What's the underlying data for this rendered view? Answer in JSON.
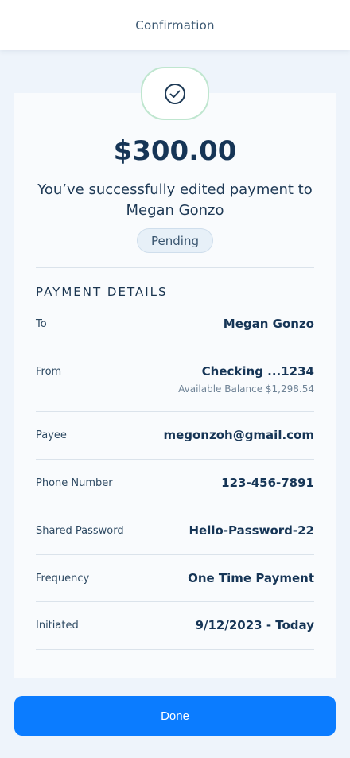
{
  "header": {
    "title": "Confirmation"
  },
  "summary": {
    "amount": "$300.00",
    "message": "You’ve successfully edited payment to Megan Gonzo",
    "status": "Pending",
    "status_icon": "check-circle-icon"
  },
  "details": {
    "section_title": "PAYMENT DETAILS",
    "rows": [
      {
        "label": "To",
        "value": "Megan Gonzo"
      },
      {
        "label": "From",
        "value": "Checking ...1234",
        "sub": "Available Balance $1,298.54"
      },
      {
        "label": "Payee",
        "value": "megonzoh@gmail.com"
      },
      {
        "label": "Phone Number",
        "value": "123-456-7891"
      },
      {
        "label": "Shared Password",
        "value": "Hello-Password-22"
      },
      {
        "label": "Frequency",
        "value": "One Time Payment"
      },
      {
        "label": "Initiated",
        "value": "9/12/2023 - Today"
      }
    ]
  },
  "actions": {
    "done_label": "Done"
  },
  "colors": {
    "accent": "#0b7cff",
    "success_border": "#bfe6cf",
    "text_dark": "#163556",
    "background": "#eef4fb"
  }
}
